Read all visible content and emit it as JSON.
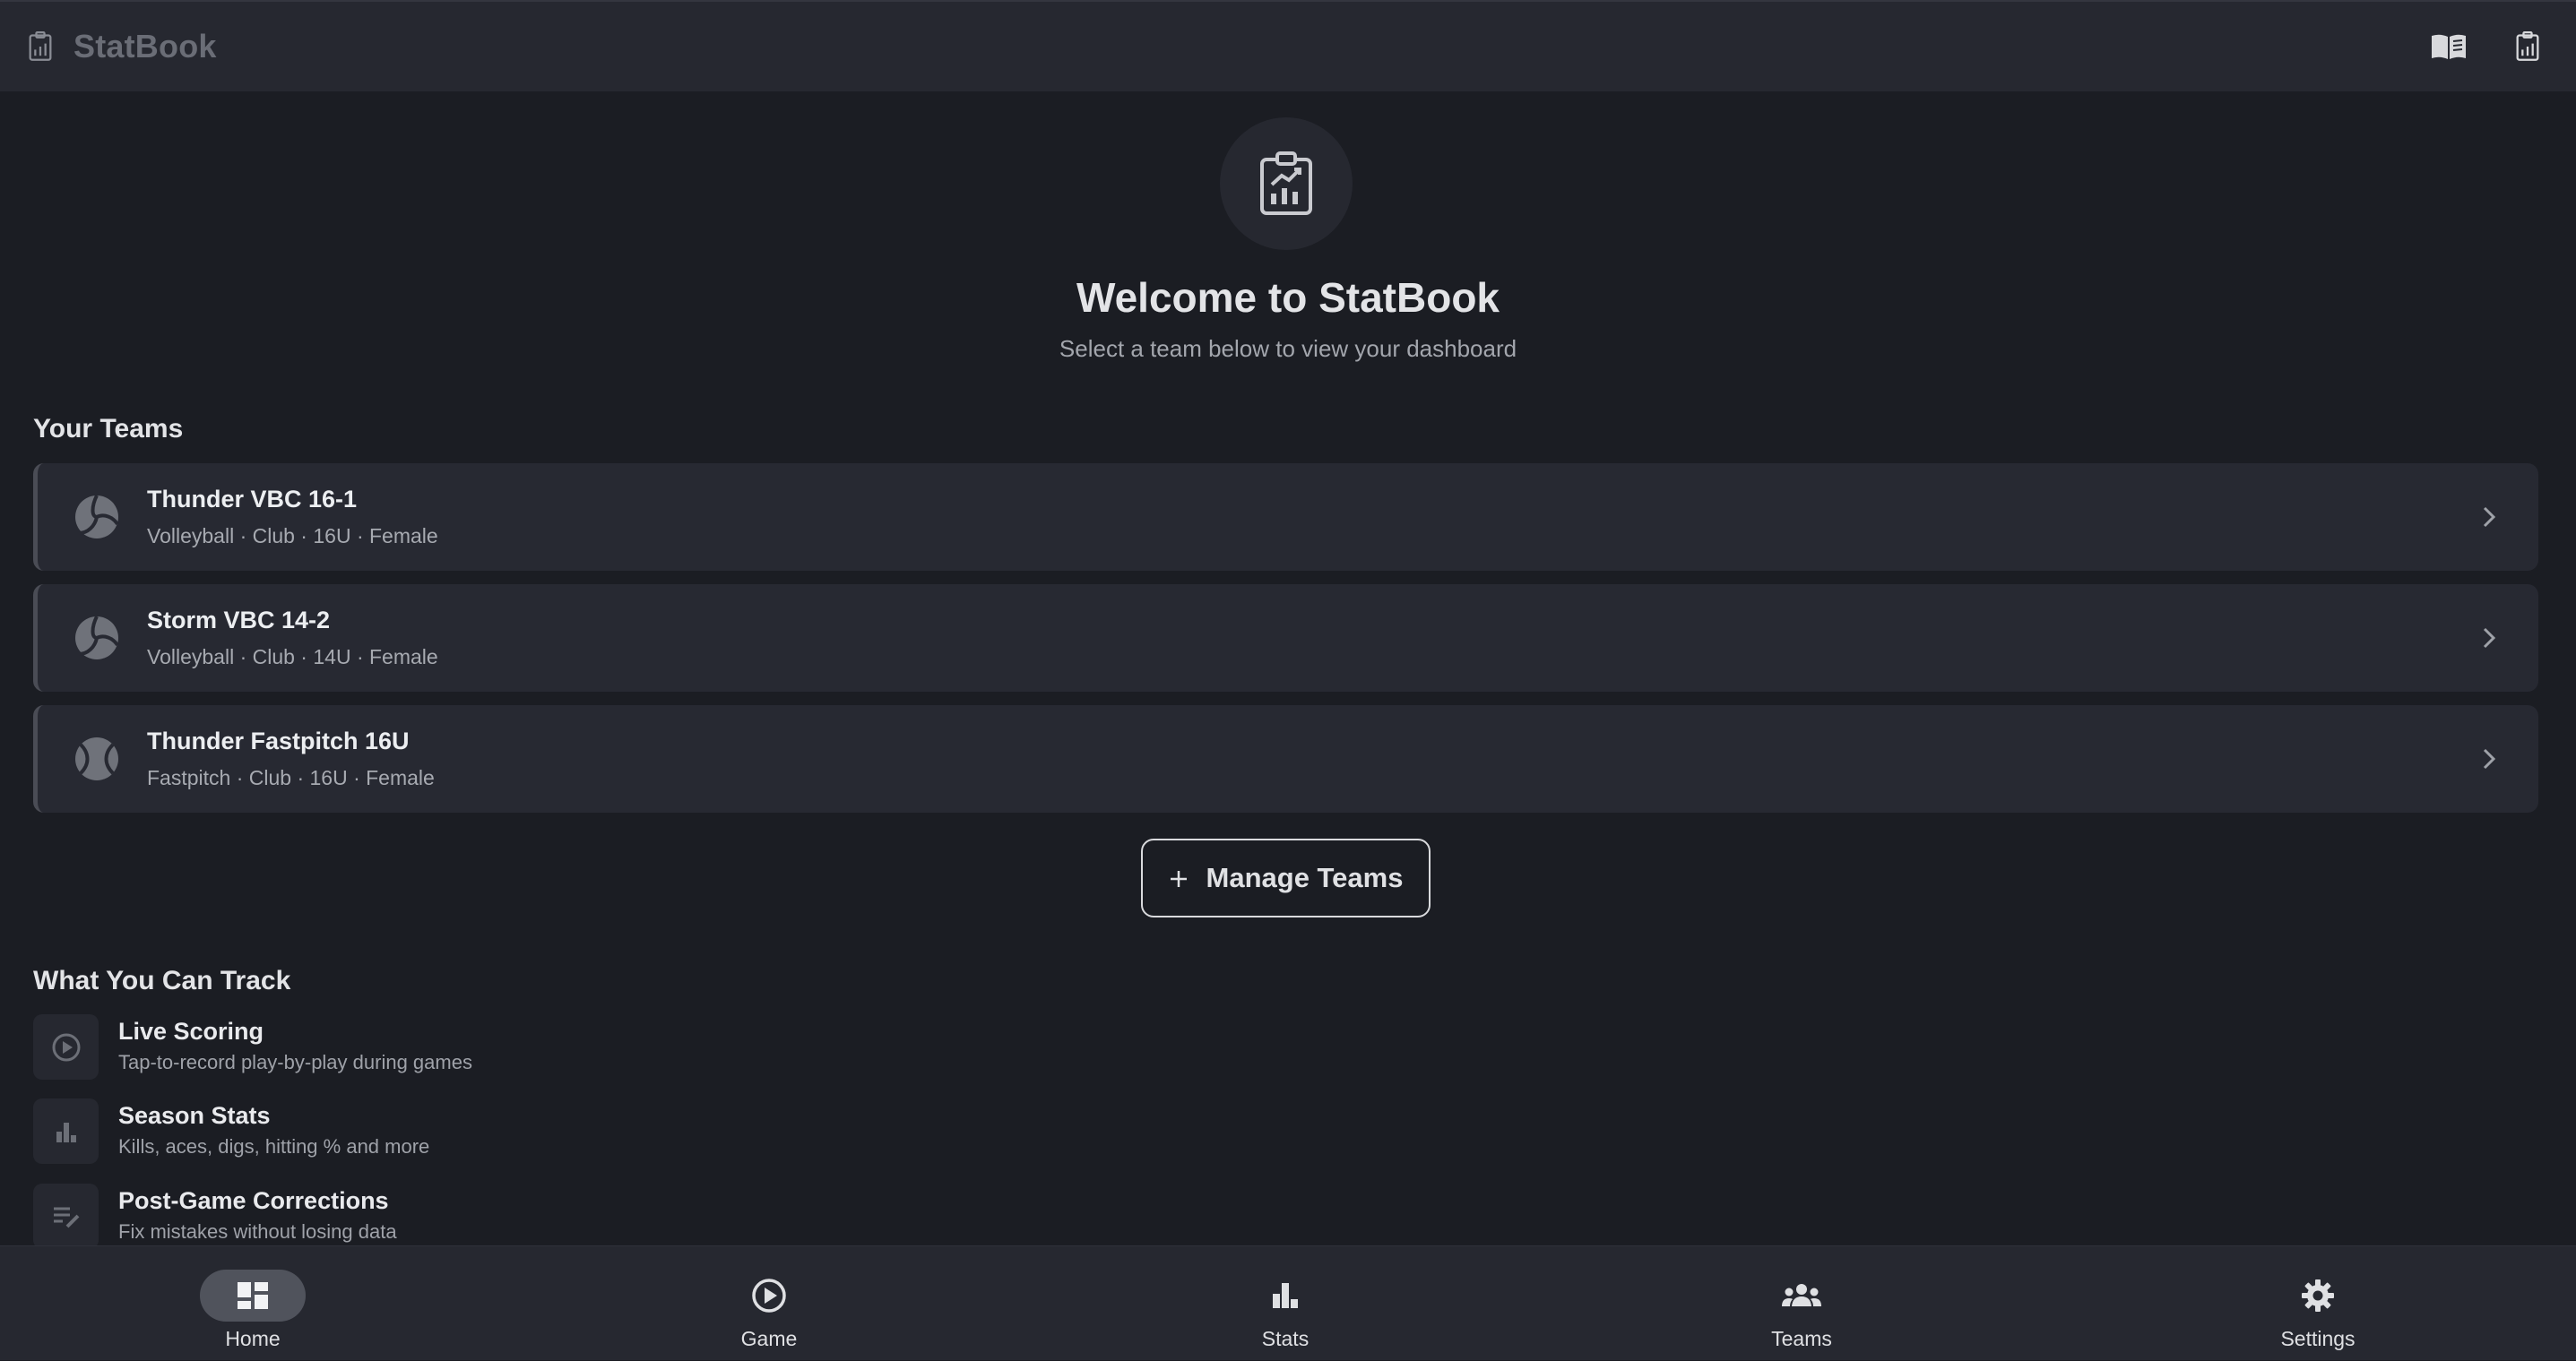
{
  "app": {
    "title": "StatBook"
  },
  "topbar": {
    "icons": [
      "clipboard-chart-icon",
      "book-open-icon",
      "clipboard-chart-icon"
    ]
  },
  "hero": {
    "title": "Welcome to StatBook",
    "subtitle": "Select a team below to view your dashboard",
    "icon": "clipboard-chart-icon"
  },
  "teams": {
    "heading": "Your Teams",
    "items": [
      {
        "name": "Thunder VBC 16-1",
        "meta": "Volleyball · Club · 16U · Female",
        "icon": "volleyball-icon"
      },
      {
        "name": "Storm VBC 14-2",
        "meta": "Volleyball · Club · 14U · Female",
        "icon": "volleyball-icon"
      },
      {
        "name": "Thunder Fastpitch 16U",
        "meta": "Fastpitch · Club · 16U · Female",
        "icon": "softball-icon"
      }
    ],
    "manage_label": "Manage Teams",
    "manage_icon": "plus-icon"
  },
  "features": {
    "heading": "What You Can Track",
    "items": [
      {
        "name": "Live Scoring",
        "desc": "Tap-to-record play-by-play during games",
        "icon": "play-circle-icon"
      },
      {
        "name": "Season Stats",
        "desc": "Kills, aces, digs, hitting % and more",
        "icon": "bar-chart-icon"
      },
      {
        "name": "Post-Game Corrections",
        "desc": "Fix mistakes without losing data",
        "icon": "edit-list-icon"
      }
    ]
  },
  "nav": {
    "items": [
      {
        "label": "Home",
        "icon": "dashboard-icon",
        "active": true
      },
      {
        "label": "Game",
        "icon": "play-circle-icon",
        "active": false
      },
      {
        "label": "Stats",
        "icon": "bar-chart-icon",
        "active": false
      },
      {
        "label": "Teams",
        "icon": "groups-icon",
        "active": false
      },
      {
        "label": "Settings",
        "icon": "gear-icon",
        "active": false
      }
    ]
  },
  "colors": {
    "background": "#1b1d23",
    "surface": "#262830",
    "card": "#272932",
    "text": "#e6e7ea",
    "muted": "#a3a6ad",
    "active_pill": "#50535c"
  }
}
